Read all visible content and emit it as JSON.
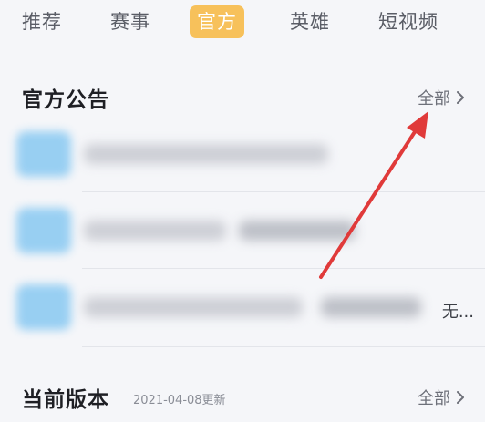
{
  "tabs": [
    {
      "label": "推荐",
      "active": false
    },
    {
      "label": "赛事",
      "active": false
    },
    {
      "label": "官方",
      "active": true
    },
    {
      "label": "英雄",
      "active": false
    },
    {
      "label": "短视频",
      "active": false
    }
  ],
  "announcements": {
    "title": "官方公告",
    "more_label": "全部",
    "items": [
      {
        "visible_text": ""
      },
      {
        "visible_text": ""
      },
      {
        "visible_text": "无..."
      }
    ]
  },
  "current_version": {
    "title": "当前版本",
    "subtitle": "2021-04-08更新",
    "more_label": "全部"
  },
  "colors": {
    "active_tab_bg": "#f7c15b",
    "annotation_arrow": "#e03a3a",
    "page_bg": "#f5f6f9"
  },
  "icons": {
    "more_chevron": "chevron-right-icon",
    "annotation": "red-arrow-annotation"
  }
}
